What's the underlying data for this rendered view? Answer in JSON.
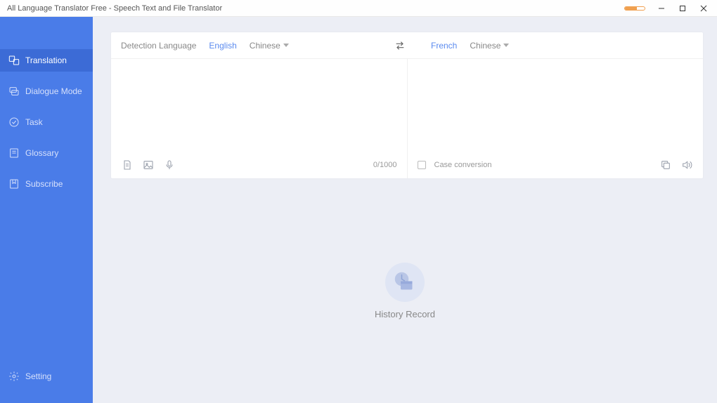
{
  "window": {
    "title": "All Language Translator Free - Speech Text and File Translator"
  },
  "sidebar": {
    "items": [
      {
        "label": "Translation"
      },
      {
        "label": "Dialogue Mode"
      },
      {
        "label": "Task"
      },
      {
        "label": "Glossary"
      },
      {
        "label": "Subscribe"
      }
    ],
    "bottom": {
      "label": "Setting"
    }
  },
  "source": {
    "detect_label": "Detection Language",
    "lang1": "English",
    "lang2": "Chinese",
    "counter": "0/1000"
  },
  "target": {
    "lang1": "French",
    "lang2": "Chinese",
    "case_label": "Case conversion"
  },
  "history": {
    "label": "History Record"
  }
}
